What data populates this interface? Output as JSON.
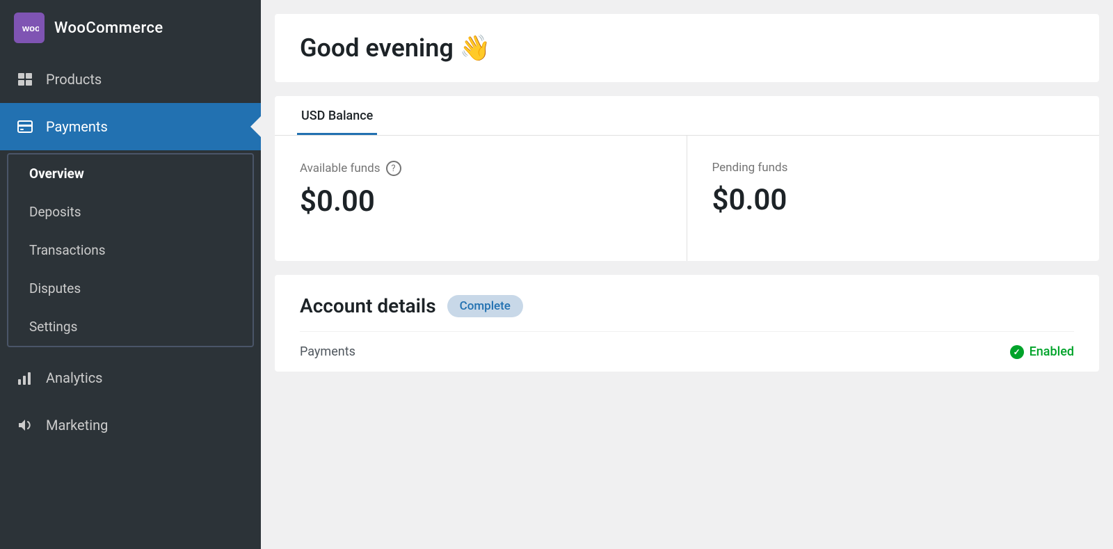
{
  "sidebar": {
    "brand": {
      "logo_text": "woo",
      "name": "WooCommerce"
    },
    "items": [
      {
        "id": "products",
        "label": "Products",
        "icon": "🖼",
        "active": false
      },
      {
        "id": "payments",
        "label": "Payments",
        "icon": "$",
        "active": true
      },
      {
        "id": "analytics",
        "label": "Analytics",
        "icon": "📊",
        "active": false
      },
      {
        "id": "marketing",
        "label": "Marketing",
        "icon": "📣",
        "active": false
      }
    ],
    "submenu": {
      "visible": true,
      "items": [
        {
          "id": "overview",
          "label": "Overview",
          "active": true
        },
        {
          "id": "deposits",
          "label": "Deposits",
          "active": false
        },
        {
          "id": "transactions",
          "label": "Transactions",
          "active": false
        },
        {
          "id": "disputes",
          "label": "Disputes",
          "active": false
        },
        {
          "id": "settings",
          "label": "Settings",
          "active": false
        }
      ]
    }
  },
  "main": {
    "greeting": {
      "text": "Good evening",
      "emoji": "👋"
    },
    "balance_card": {
      "tabs": [
        {
          "id": "usd",
          "label": "USD Balance",
          "active": true
        }
      ],
      "cells": [
        {
          "id": "available",
          "label": "Available funds",
          "amount": "$0.00",
          "has_help": true
        },
        {
          "id": "pending",
          "label": "Pending funds",
          "amount": "$0.00",
          "has_help": false
        }
      ]
    },
    "account_details": {
      "title": "Account details",
      "badge": "Complete",
      "rows": [
        {
          "id": "payments",
          "label": "Payments",
          "status": "Enabled",
          "status_type": "enabled"
        }
      ]
    }
  }
}
